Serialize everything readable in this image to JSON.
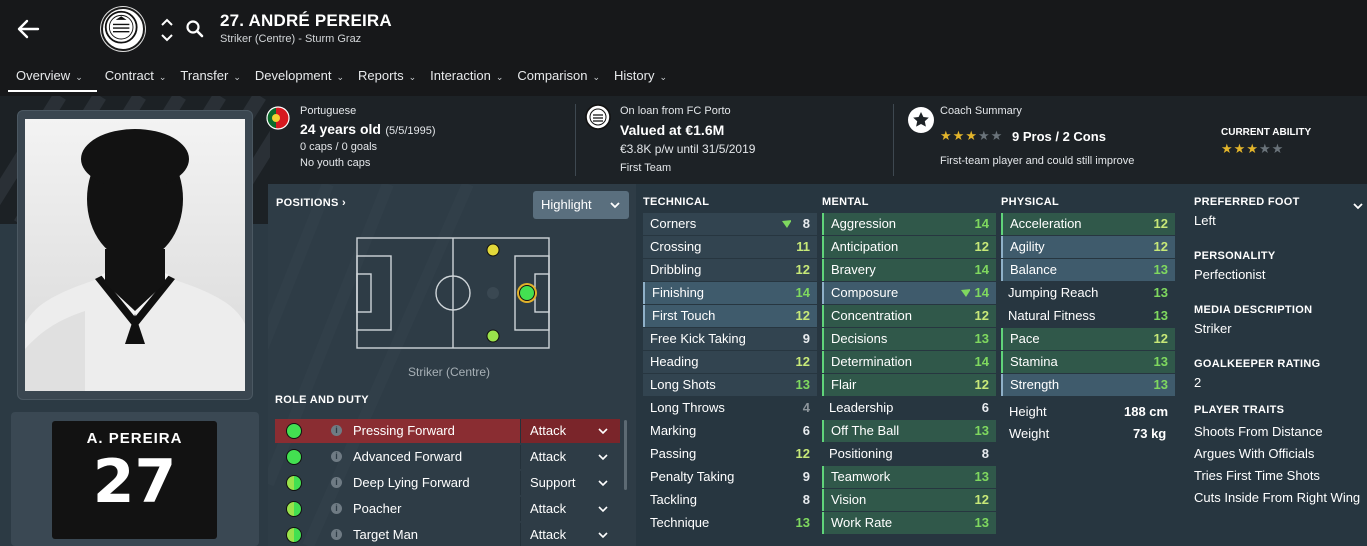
{
  "header": {
    "title": "27. ANDRÉ PEREIRA",
    "subtitle": "Striker (Centre) - Sturm Graz"
  },
  "tabs": [
    {
      "label": "Overview"
    },
    {
      "label": "Contract"
    },
    {
      "label": "Transfer"
    },
    {
      "label": "Development"
    },
    {
      "label": "Reports"
    },
    {
      "label": "Interaction"
    },
    {
      "label": "Comparison"
    },
    {
      "label": "History"
    }
  ],
  "info": {
    "nationality": "Portuguese",
    "age": "24 years old",
    "dob": "(5/5/1995)",
    "caps": "0 caps / 0 goals",
    "youth_caps": "No youth caps",
    "loan": "On loan from FC Porto",
    "value": "Valued at €1.6M",
    "wage": "€3.8K p/w until 31/5/2019",
    "squad_status": "First Team",
    "coach_summary_label": "Coach Summary",
    "pros_cons": "9 Pros / 2 Cons",
    "coach_note": "First-team player and could still improve",
    "coach_stars": 3,
    "current_ability_label": "CURRENT ABILITY",
    "current_ability_stars": 3
  },
  "shirt": {
    "name": "A. PEREIRA",
    "number": "27"
  },
  "positions": {
    "heading": "POSITIONS",
    "highlight_label": "Highlight",
    "caption": "Striker (Centre)"
  },
  "roles": {
    "heading": "ROLE AND DUTY",
    "items": [
      {
        "name": "Pressing Forward",
        "duty": "Attack"
      },
      {
        "name": "Advanced Forward",
        "duty": "Attack"
      },
      {
        "name": "Deep Lying Forward",
        "duty": "Support"
      },
      {
        "name": "Poacher",
        "duty": "Attack"
      },
      {
        "name": "Target Man",
        "duty": "Attack"
      }
    ]
  },
  "attributes": {
    "technical_label": "TECHNICAL",
    "mental_label": "MENTAL",
    "physical_label": "PHYSICAL",
    "technical": [
      {
        "name": "Corners",
        "value": "8"
      },
      {
        "name": "Crossing",
        "value": "11"
      },
      {
        "name": "Dribbling",
        "value": "12"
      },
      {
        "name": "Finishing",
        "value": "14"
      },
      {
        "name": "First Touch",
        "value": "12"
      },
      {
        "name": "Free Kick Taking",
        "value": "9"
      },
      {
        "name": "Heading",
        "value": "12"
      },
      {
        "name": "Long Shots",
        "value": "13"
      },
      {
        "name": "Long Throws",
        "value": "4"
      },
      {
        "name": "Marking",
        "value": "6"
      },
      {
        "name": "Passing",
        "value": "12"
      },
      {
        "name": "Penalty Taking",
        "value": "9"
      },
      {
        "name": "Tackling",
        "value": "8"
      },
      {
        "name": "Technique",
        "value": "13"
      }
    ],
    "mental": [
      {
        "name": "Aggression",
        "value": "14"
      },
      {
        "name": "Anticipation",
        "value": "12"
      },
      {
        "name": "Bravery",
        "value": "14"
      },
      {
        "name": "Composure",
        "value": "14"
      },
      {
        "name": "Concentration",
        "value": "12"
      },
      {
        "name": "Decisions",
        "value": "13"
      },
      {
        "name": "Determination",
        "value": "14"
      },
      {
        "name": "Flair",
        "value": "12"
      },
      {
        "name": "Leadership",
        "value": "6"
      },
      {
        "name": "Off The Ball",
        "value": "13"
      },
      {
        "name": "Positioning",
        "value": "8"
      },
      {
        "name": "Teamwork",
        "value": "13"
      },
      {
        "name": "Vision",
        "value": "12"
      },
      {
        "name": "Work Rate",
        "value": "13"
      }
    ],
    "physical": [
      {
        "name": "Acceleration",
        "value": "12"
      },
      {
        "name": "Agility",
        "value": "12"
      },
      {
        "name": "Balance",
        "value": "13"
      },
      {
        "name": "Jumping Reach",
        "value": "13"
      },
      {
        "name": "Natural Fitness",
        "value": "13"
      },
      {
        "name": "Pace",
        "value": "12"
      },
      {
        "name": "Stamina",
        "value": "13"
      },
      {
        "name": "Strength",
        "value": "13"
      }
    ],
    "height_label": "Height",
    "height": "188 cm",
    "weight_label": "Weight",
    "weight": "73 kg"
  },
  "sidebar": {
    "preferred_foot_label": "PREFERRED FOOT",
    "preferred_foot": "Left",
    "personality_label": "PERSONALITY",
    "personality": "Perfectionist",
    "media_label": "MEDIA DESCRIPTION",
    "media": "Striker",
    "gk_label": "GOALKEEPER RATING",
    "gk": "2",
    "traits_label": "PLAYER TRAITS",
    "traits": [
      "Shoots From Distance",
      "Argues With Officials",
      "Tries First Time Shots",
      "Cuts Inside From Right Wing"
    ]
  },
  "colors": {
    "accent_green": "#43e051",
    "selected_role": "#8a2d32",
    "highlight_row": "#3f5b6c",
    "key_row": "#30584a"
  }
}
